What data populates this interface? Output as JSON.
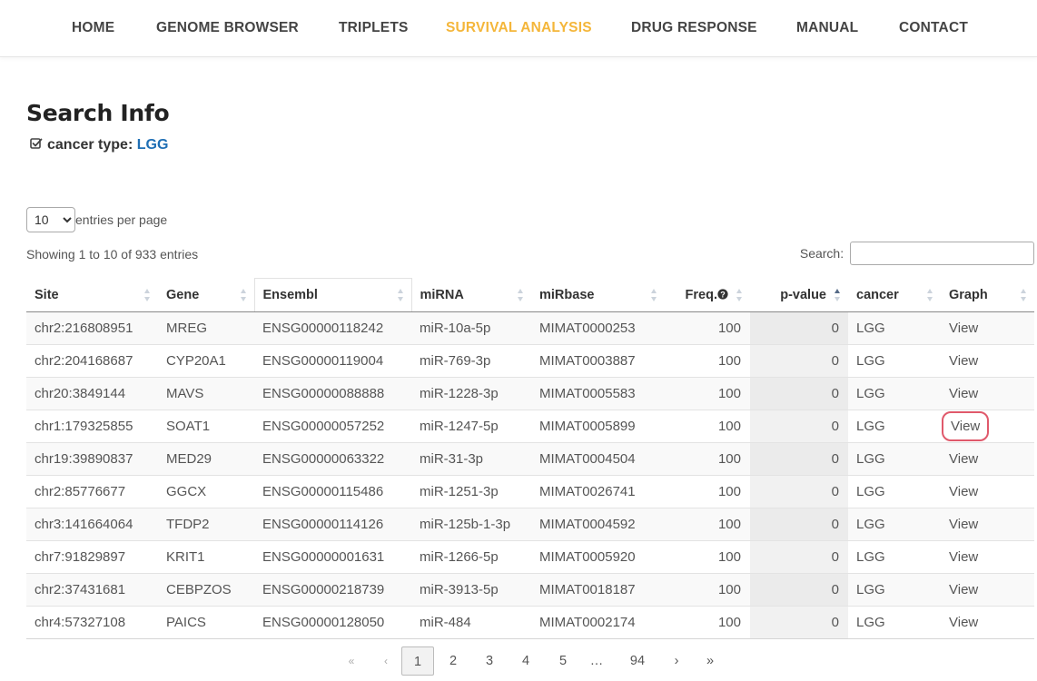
{
  "nav": {
    "items": [
      "HOME",
      "GENOME BROWSER",
      "TRIPLETS",
      "SURVIVAL ANALYSIS",
      "DRUG RESPONSE",
      "MANUAL",
      "CONTACT"
    ],
    "active": "SURVIVAL ANALYSIS",
    "active_color": "#f4b63a"
  },
  "search_info": {
    "title": "Search Info",
    "label": "cancer type:",
    "value": "LGG",
    "icon": "check-square-icon"
  },
  "table_controls": {
    "page_length": "10",
    "page_length_options": [
      "10"
    ],
    "entries_label": "entries per page",
    "info": "Showing 1 to 10 of 933 entries",
    "search_label": "Search:",
    "search_value": ""
  },
  "table": {
    "columns": [
      "Site",
      "Gene",
      "Ensembl",
      "miRNA",
      "miRbase",
      "Freq.",
      "p-value",
      "cancer",
      "Graph"
    ],
    "freq_help_icon": "question-circle-icon",
    "sorted_column": "p-value",
    "sort_direction": "asc",
    "rows": [
      [
        "chr2:216808951",
        "MREG",
        "ENSG00000118242",
        "miR-10a-5p",
        "MIMAT0000253",
        "100",
        "0",
        "LGG",
        "View"
      ],
      [
        "chr2:204168687",
        "CYP20A1",
        "ENSG00000119004",
        "miR-769-3p",
        "MIMAT0003887",
        "100",
        "0",
        "LGG",
        "View"
      ],
      [
        "chr20:3849144",
        "MAVS",
        "ENSG00000088888",
        "miR-1228-3p",
        "MIMAT0005583",
        "100",
        "0",
        "LGG",
        "View"
      ],
      [
        "chr1:179325855",
        "SOAT1",
        "ENSG00000057252",
        "miR-1247-5p",
        "MIMAT0005899",
        "100",
        "0",
        "LGG",
        "View"
      ],
      [
        "chr19:39890837",
        "MED29",
        "ENSG00000063322",
        "miR-31-3p",
        "MIMAT0004504",
        "100",
        "0",
        "LGG",
        "View"
      ],
      [
        "chr2:85776677",
        "GGCX",
        "ENSG00000115486",
        "miR-1251-3p",
        "MIMAT0026741",
        "100",
        "0",
        "LGG",
        "View"
      ],
      [
        "chr3:141664064",
        "TFDP2",
        "ENSG00000114126",
        "miR-125b-1-3p",
        "MIMAT0004592",
        "100",
        "0",
        "LGG",
        "View"
      ],
      [
        "chr7:91829897",
        "KRIT1",
        "ENSG00000001631",
        "miR-1266-5p",
        "MIMAT0005920",
        "100",
        "0",
        "LGG",
        "View"
      ],
      [
        "chr2:37431681",
        "CEBPZOS",
        "ENSG00000218739",
        "miR-3913-5p",
        "MIMAT0018187",
        "100",
        "0",
        "LGG",
        "View"
      ],
      [
        "chr4:57327108",
        "PAICS",
        "ENSG00000128050",
        "miR-484",
        "MIMAT0002174",
        "100",
        "0",
        "LGG",
        "View"
      ]
    ],
    "highlighted_row": 3,
    "highlight_color": "#e0596b"
  },
  "pagination": {
    "first": "«",
    "prev": "‹",
    "pages": [
      "1",
      "2",
      "3",
      "4",
      "5",
      "…",
      "94"
    ],
    "current": "1",
    "next": "›",
    "last": "»"
  }
}
